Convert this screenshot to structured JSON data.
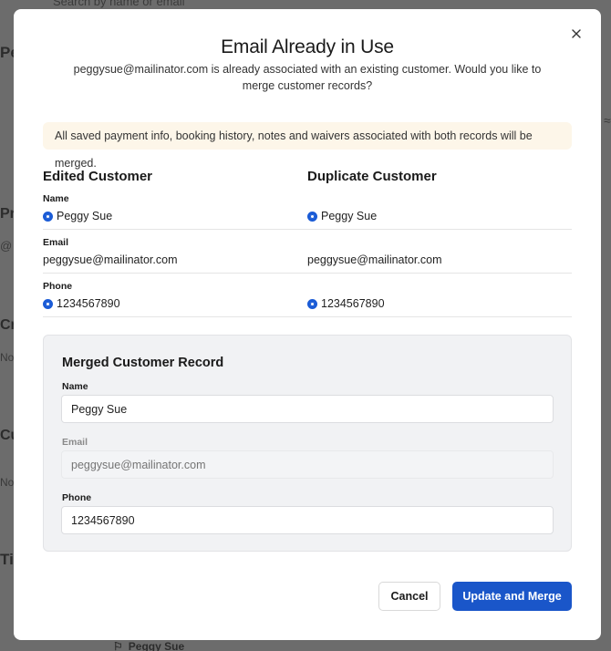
{
  "background": {
    "search_placeholder": "Search by name or email",
    "section_pe": "Pe",
    "section_pr": "Pr",
    "at_text": "@",
    "section_cr": "Cr",
    "no_text_1": "No",
    "section_cu": "Cu",
    "no_text_2": "No",
    "section_ti": "Ti",
    "footer_name": "Peggy Sue"
  },
  "modal": {
    "title": "Email Already in Use",
    "subtitle": "peggysue@mailinator.com is already associated with an existing customer. Would you like to merge customer records?",
    "notice": "All saved payment info, booking history, notes and waivers associated with both records will be merged.",
    "edited_heading": "Edited Customer",
    "duplicate_heading": "Duplicate Customer",
    "fields": [
      {
        "label": "Name",
        "edited": "Peggy Sue",
        "duplicate": "Peggy Sue"
      },
      {
        "label": "Email",
        "edited": "peggysue@mailinator.com",
        "duplicate": "peggysue@mailinator.com"
      },
      {
        "label": "Phone",
        "edited": "1234567890",
        "duplicate": "1234567890"
      }
    ],
    "merged": {
      "title": "Merged Customer Record",
      "name_label": "Name",
      "name_value": "Peggy Sue",
      "email_label": "Email",
      "email_placeholder": "peggysue@mailinator.com",
      "phone_label": "Phone",
      "phone_value": "1234567890"
    },
    "cancel_label": "Cancel",
    "submit_label": "Update and Merge"
  },
  "colors": {
    "accent": "#1a56c9",
    "radio": "#1a5bd6",
    "notice_bg": "#fdf6e9",
    "overlay": "#6c6c6c"
  },
  "icons": {
    "close": "close-icon",
    "radio": "radio-selected-icon",
    "flag": "flag-icon"
  }
}
